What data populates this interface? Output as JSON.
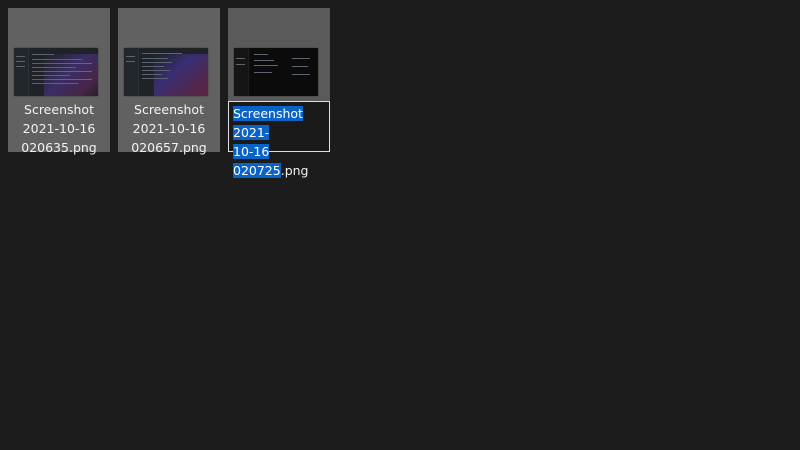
{
  "files": [
    {
      "line1": "Screenshot",
      "line2": "2021-10-16",
      "line3": "020635.png"
    },
    {
      "line1": "Screenshot",
      "line2": "2021-10-16",
      "line3": "020657.png"
    },
    {
      "selected_text_line1": "Screenshot 2021-",
      "selected_text_line2": "10-16 020725",
      "extension": ".png"
    }
  ],
  "colors": {
    "background": "#1c1c1c",
    "tile": "#616161",
    "selection": "#0a64c8"
  }
}
